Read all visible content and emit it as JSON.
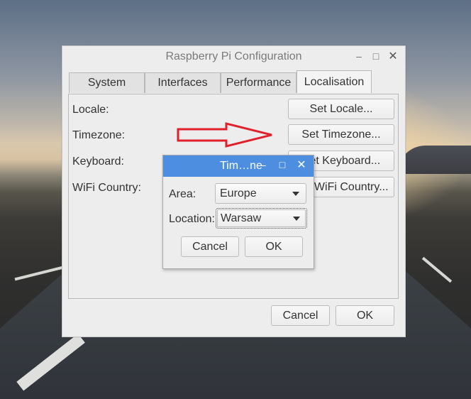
{
  "window": {
    "title": "Raspberry Pi Configuration",
    "controls": {
      "minimize": "–",
      "maximize": "□",
      "close": "✕"
    }
  },
  "tabs": [
    {
      "label": "System",
      "active": false
    },
    {
      "label": "Interfaces",
      "active": false
    },
    {
      "label": "Performance",
      "active": false
    },
    {
      "label": "Localisation",
      "active": true
    }
  ],
  "localisation": {
    "rows": [
      {
        "label": "Locale:",
        "button": "Set Locale..."
      },
      {
        "label": "Timezone:",
        "button": "Set Timezone..."
      },
      {
        "label": "Keyboard:",
        "button": "Set Keyboard..."
      },
      {
        "label": "WiFi Country:",
        "button": "Set WiFi Country..."
      }
    ]
  },
  "footer": {
    "cancel": "Cancel",
    "ok": "OK"
  },
  "timezone_dialog": {
    "title": "Tim…ne",
    "controls": {
      "minimize": "–",
      "maximize": "□",
      "close": "✕"
    },
    "area_label": "Area:",
    "area_value": "Europe",
    "location_label": "Location:",
    "location_value": "Warsaw",
    "cancel": "Cancel",
    "ok": "OK",
    "title_bar_color": "#4d8ee0"
  },
  "annotation": {
    "arrow_color": "#e0202a",
    "icon": "right-arrow-icon"
  }
}
